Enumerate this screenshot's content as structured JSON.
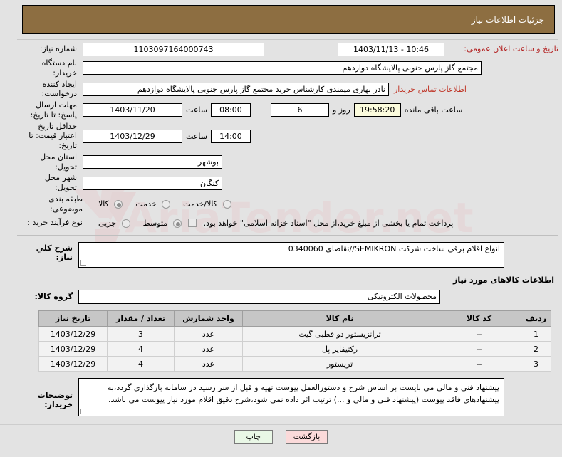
{
  "header": {
    "title": "جزئیات اطلاعات نیاز",
    "bar_color": "#8d6e41"
  },
  "fields": {
    "need_number_label": "شماره نیاز:",
    "need_number_value": "1103097164000743",
    "announce_label": "تاریخ و ساعت اعلان عمومی:",
    "announce_value": "10:46 - 1403/11/13",
    "buyer_org_label": "نام دستگاه خریدار:",
    "buyer_org_value": "مجتمع گاز پارس جنوبی  پالایشگاه دوازدهم",
    "requester_label": "ایجاد کننده درخواست:",
    "requester_value": "نادر بهاری میمندی کارشناس خرید مجتمع گاز پارس جنوبی  پالایشگاه دوازدهم",
    "contact_link": "اطلاعات تماس خریدار",
    "deadline_label": "مهلت ارسال پاسخ: تا تاریخ:",
    "deadline_date": "1403/11/20",
    "hour_label": "ساعت",
    "deadline_time": "08:00",
    "remaining_days": "6",
    "days_and_label": "روز و",
    "remaining_time": "19:58:20",
    "remaining_suffix": "ساعت باقی مانده",
    "validity_label": "حداقل تاریخ اعتبار قیمت: تا تاریخ:",
    "validity_date": "1403/12/29",
    "validity_time": "14:00",
    "province_label": "استان محل تحویل:",
    "province_value": "بوشهر",
    "city_label": "شهر محل تحویل:",
    "city_value": "کنگان",
    "category_label": "طبقه بندی موضوعی:",
    "category_options": [
      "کالا",
      "خدمت",
      "کالا/خدمت"
    ],
    "category_selected": "کالا",
    "process_label": "نوع فرآیند خرید :",
    "process_options": [
      "جزیی",
      "متوسط"
    ],
    "process_selected": "متوسط",
    "treasury_checkbox_label": "پرداخت تمام یا بخشی از مبلغ خرید،از محل \"اسناد خزانه اسلامی\" خواهد بود."
  },
  "description": {
    "label": "شرح کلي نیاز:",
    "value": "انواع اقلام برقی ساخت شرکت SEMIKRON//تقاضای 0340060"
  },
  "goods_section": {
    "heading": "اطلاعات کالاهای مورد نیاز",
    "group_label": "گروه کالا:",
    "group_value": "محصولات الکترونیکی"
  },
  "table": {
    "columns": [
      "ردیف",
      "کد کالا",
      "نام کالا",
      "واحد شمارش",
      "تعداد / مقدار",
      "تاریخ نیاز"
    ],
    "rows": [
      {
        "index": "1",
        "code": "--",
        "name": "ترانزیستور دو قطبی گیت",
        "unit": "عدد",
        "qty": "3",
        "date": "1403/12/29"
      },
      {
        "index": "2",
        "code": "--",
        "name": "رکتیفایر پل",
        "unit": "عدد",
        "qty": "4",
        "date": "1403/12/29"
      },
      {
        "index": "3",
        "code": "--",
        "name": "تریستور",
        "unit": "عدد",
        "qty": "4",
        "date": "1403/12/29"
      }
    ]
  },
  "notes": {
    "label": "توضیحات خریدار:",
    "value": "پیشنهاد فنی و مالی می بایست بر اساس شرح و دستورالعمل پیوست تهیه و قبل از سر رسید در سامانه بارگذاری گردد،به پیشنهادهای فاقد پیوست (پیشنهاد فنی و مالی و ...) ترتیب اثر داده نمی شود،شرح دقیق اقلام مورد نیاز پیوست می باشد."
  },
  "buttons": {
    "print": "چاپ",
    "back": "بازگشت"
  },
  "watermark": {
    "text": "AriaTender.net"
  }
}
